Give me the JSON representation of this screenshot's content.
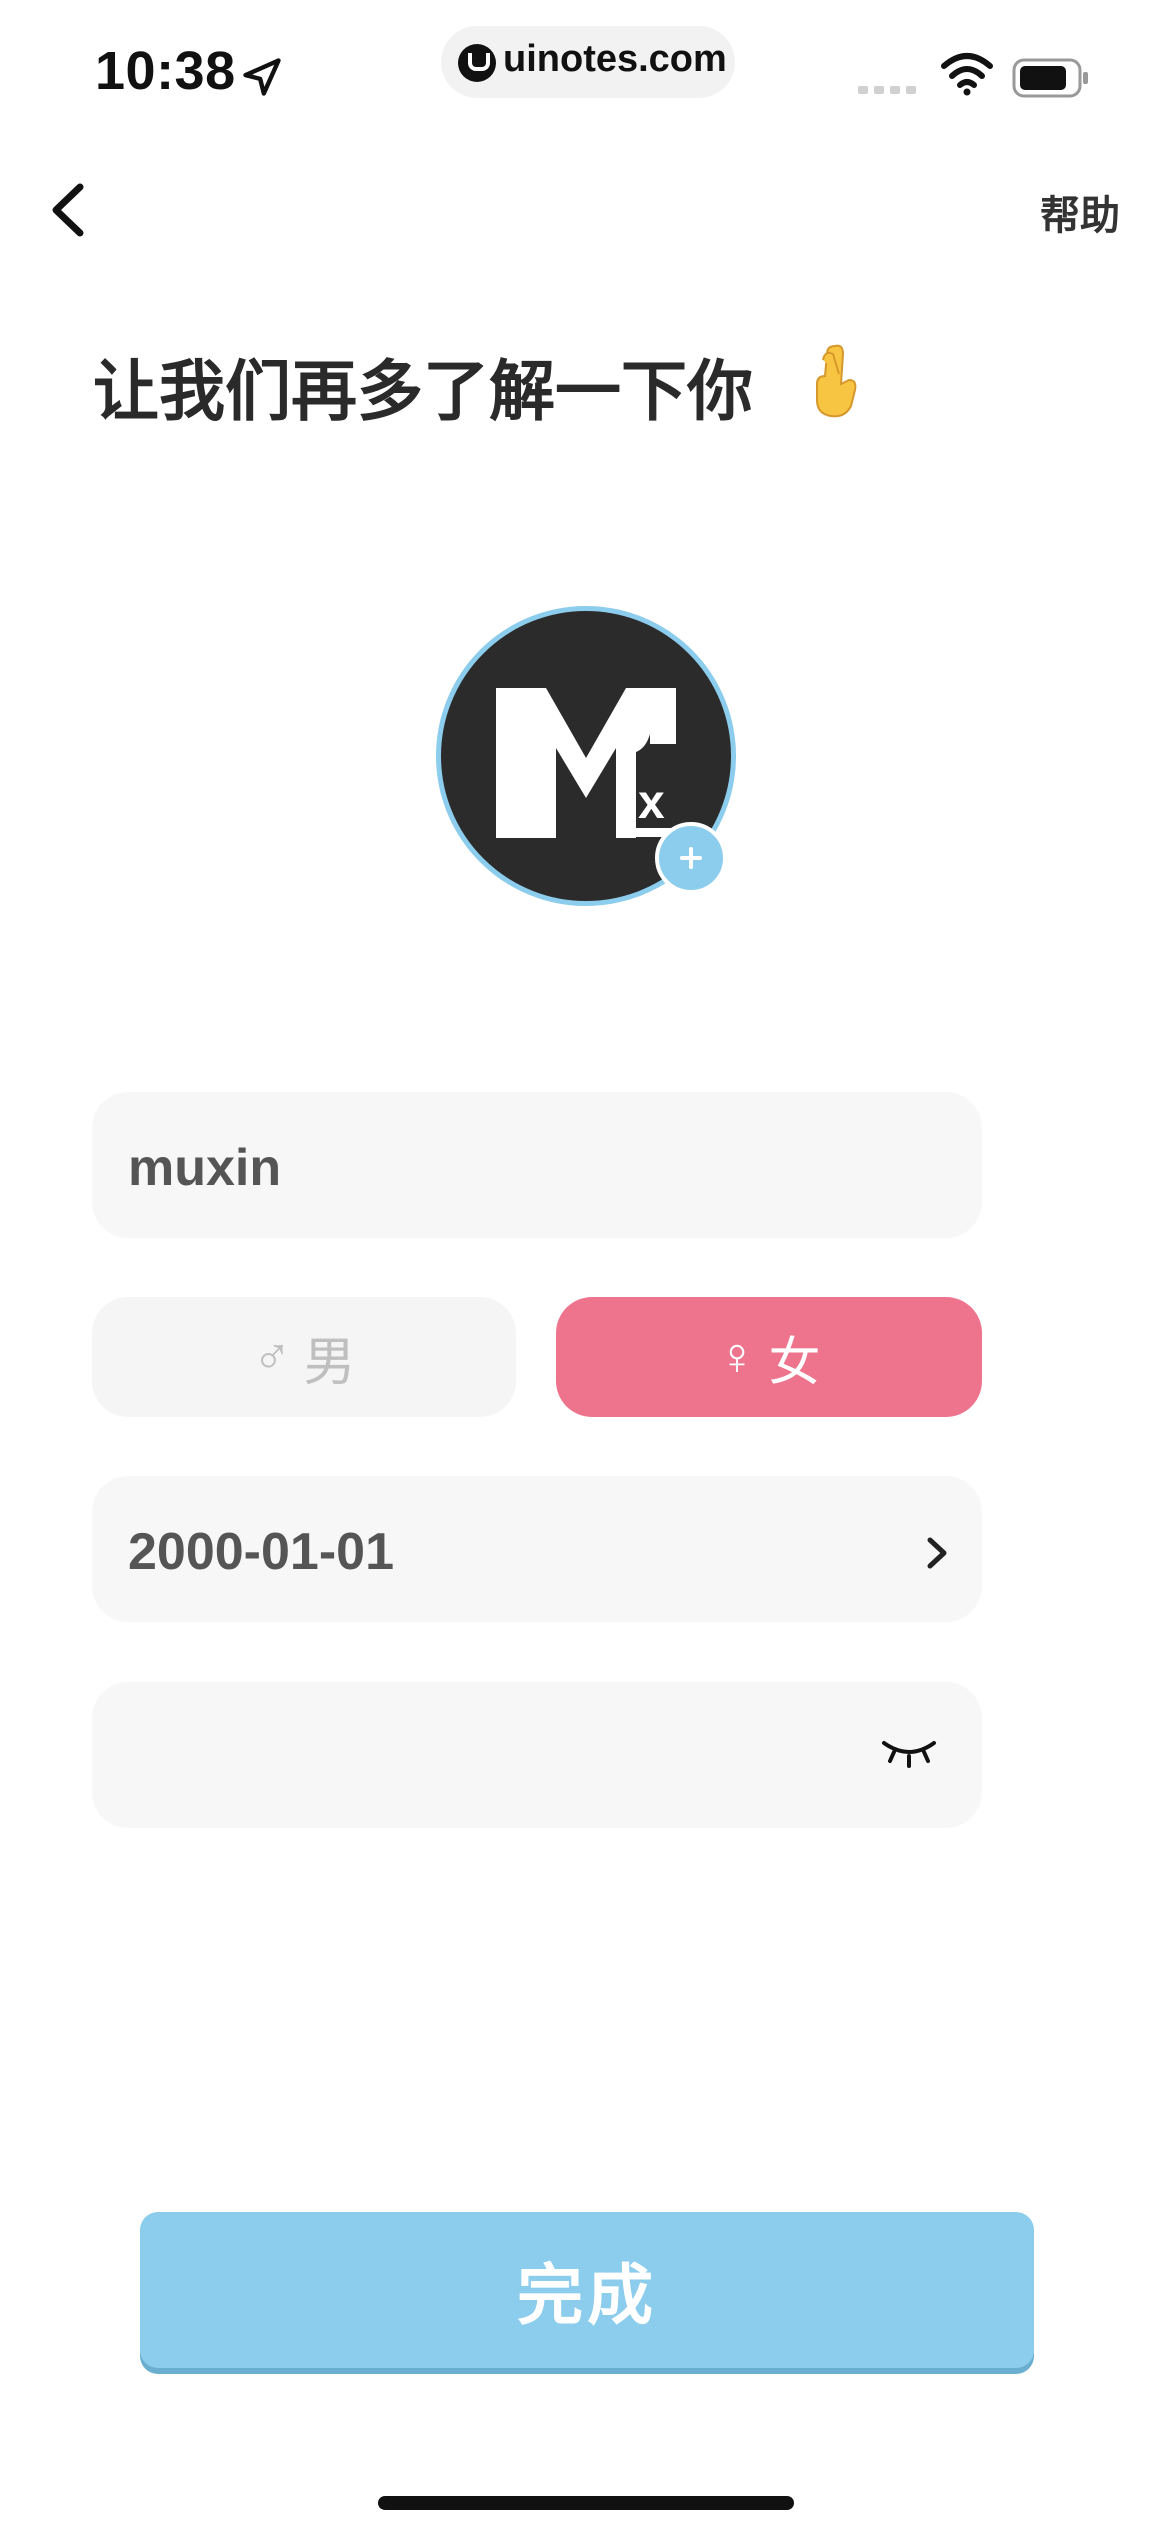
{
  "status_bar": {
    "time": "10:38",
    "url": "uinotes.com"
  },
  "nav": {
    "help": "帮助"
  },
  "page": {
    "title": "让我们再多了解一下你"
  },
  "form": {
    "nickname": "muxin",
    "gender": {
      "male_symbol": "♂",
      "male": "男",
      "female_symbol": "♀",
      "female": "女",
      "selected": "female"
    },
    "birthday": "2000-01-01",
    "password": ""
  },
  "actions": {
    "done": "完成"
  },
  "colors": {
    "accent_blue": "#8ccdee",
    "female_pink": "#ee748e",
    "field_bg": "#f7f7f7"
  }
}
